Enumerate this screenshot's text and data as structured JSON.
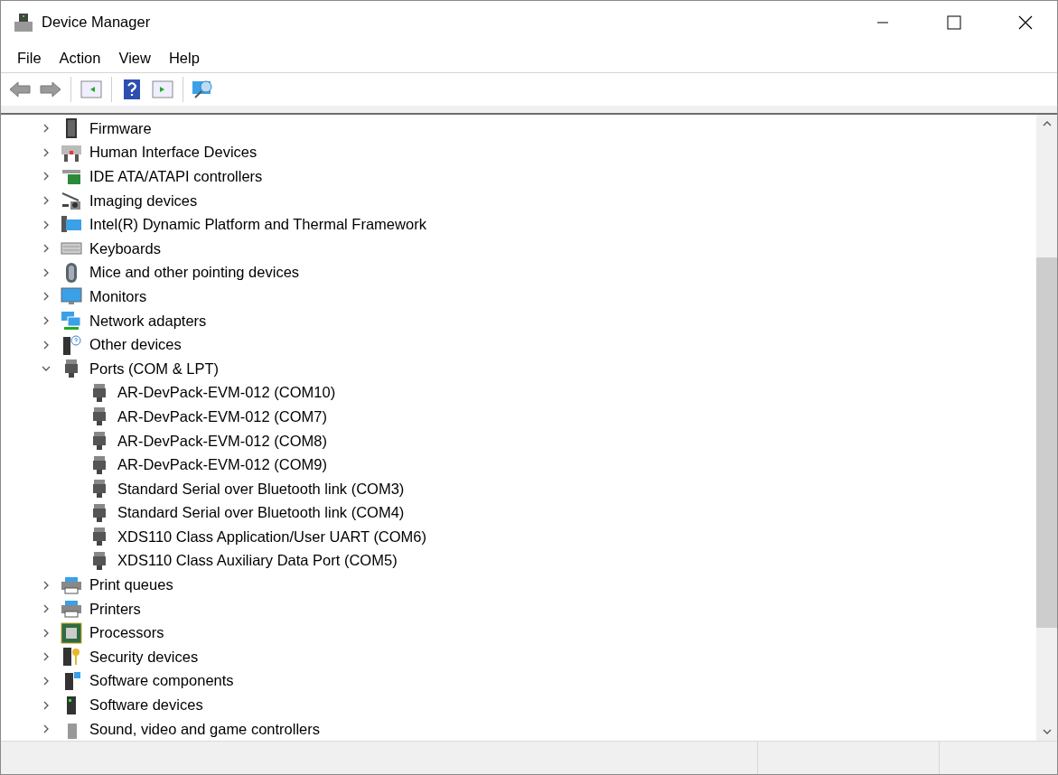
{
  "window": {
    "title": "Device Manager"
  },
  "menu": [
    "File",
    "Action",
    "View",
    "Help"
  ],
  "tree": [
    {
      "label": "Firmware",
      "expanded": false
    },
    {
      "label": "Human Interface Devices",
      "expanded": false
    },
    {
      "label": "IDE ATA/ATAPI controllers",
      "expanded": false
    },
    {
      "label": "Imaging devices",
      "expanded": false
    },
    {
      "label": "Intel(R) Dynamic Platform and Thermal Framework",
      "expanded": false
    },
    {
      "label": "Keyboards",
      "expanded": false
    },
    {
      "label": "Mice and other pointing devices",
      "expanded": false
    },
    {
      "label": "Monitors",
      "expanded": false
    },
    {
      "label": "Network adapters",
      "expanded": false
    },
    {
      "label": "Other devices",
      "expanded": false
    },
    {
      "label": "Ports (COM & LPT)",
      "expanded": true,
      "children": [
        {
          "label": "AR-DevPack-EVM-012 (COM10)"
        },
        {
          "label": "AR-DevPack-EVM-012 (COM7)"
        },
        {
          "label": "AR-DevPack-EVM-012 (COM8)"
        },
        {
          "label": "AR-DevPack-EVM-012 (COM9)"
        },
        {
          "label": "Standard Serial over Bluetooth link (COM3)"
        },
        {
          "label": "Standard Serial over Bluetooth link (COM4)"
        },
        {
          "label": "XDS110 Class Application/User UART (COM6)"
        },
        {
          "label": "XDS110 Class Auxiliary Data Port (COM5)"
        }
      ]
    },
    {
      "label": "Print queues",
      "expanded": false
    },
    {
      "label": "Printers",
      "expanded": false
    },
    {
      "label": "Processors",
      "expanded": false
    },
    {
      "label": "Security devices",
      "expanded": false
    },
    {
      "label": "Software components",
      "expanded": false
    },
    {
      "label": "Software devices",
      "expanded": false
    },
    {
      "label": "Sound, video and game controllers",
      "expanded": false
    }
  ]
}
